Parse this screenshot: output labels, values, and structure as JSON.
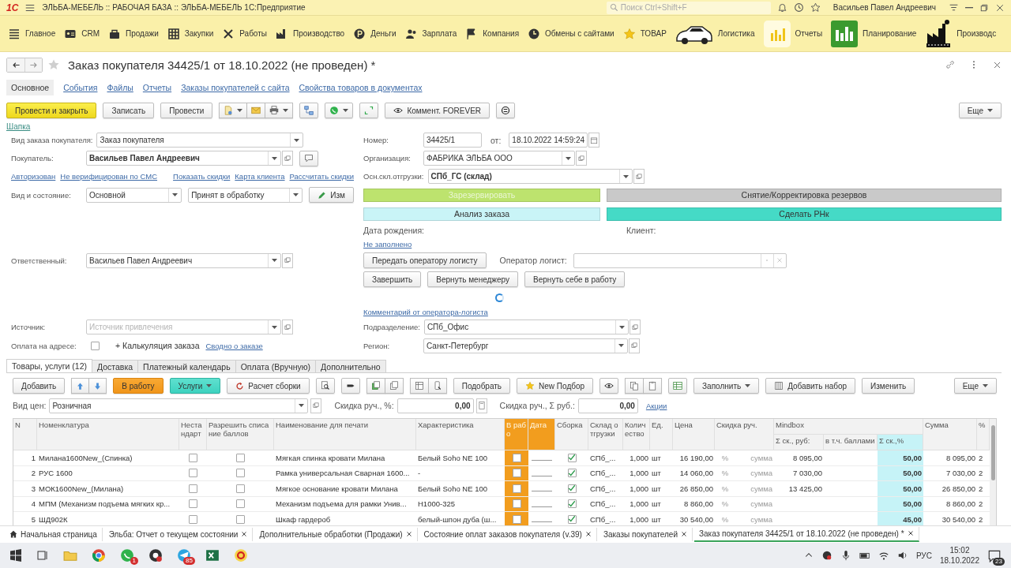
{
  "app_bar": {
    "logo": "1С",
    "title": "ЭЛЬБА-МЕБЕЛЬ :: РАБОЧАЯ БАЗА :: ЭЛЬБА-МЕБЕЛЬ 1С:Предприятие",
    "search": {
      "placeholder": "Поиск Ctrl+Shift+F"
    },
    "user": "Васильев Павел Андреевич"
  },
  "sections": [
    {
      "label": "Главное"
    },
    {
      "label": "CRM"
    },
    {
      "label": "Продажи"
    },
    {
      "label": "Закупки"
    },
    {
      "label": "Работы"
    },
    {
      "label": "Производство"
    },
    {
      "label": "Деньги"
    },
    {
      "label": "Зарплата"
    },
    {
      "label": "Компания"
    },
    {
      "label": "Обмены с сайтами"
    },
    {
      "label": "ТОВАР"
    },
    {
      "label": "Логистика"
    },
    {
      "label": "Отчеты"
    },
    {
      "label": "Планирование"
    },
    {
      "label": "Производс"
    }
  ],
  "form": {
    "title": "Заказ покупателя 34425/1 от 18.10.2022 (не проведен) *",
    "nav": [
      {
        "label": "Основное",
        "selected": true
      },
      {
        "label": "События",
        "selected": false
      },
      {
        "label": "Файлы",
        "selected": false
      },
      {
        "label": "Отчеты",
        "selected": false
      },
      {
        "label": "Заказы покупателей с сайта",
        "selected": false
      },
      {
        "label": "Свойства товаров в документах",
        "selected": false
      }
    ],
    "toolbar": {
      "post_close": "Провести и закрыть",
      "save": "Записать",
      "post": "Провести",
      "comment": "Коммент. FOREVER",
      "more": "Еще"
    },
    "group_link": "Шапка",
    "order_kind": {
      "label": "Вид заказа покупателя:",
      "value": "Заказ покупателя"
    },
    "customer": {
      "label": "Покупатель:",
      "value": "Васильев Павел Андреевич"
    },
    "customer_links": [
      "Авторизован",
      "Не верифицирован по СМС",
      "Показать скидки",
      "Карта клиента",
      "Рассчитать скидки"
    ],
    "type_state": {
      "label": "Вид и состояние:",
      "type": "Основной",
      "state": "Принят в обработку",
      "button": "Изм"
    },
    "responsible": {
      "label": "Ответственный:",
      "value": "Васильев Павел Андреевич"
    },
    "source": {
      "label": "Источник:",
      "placeholder": "Источник привлечения"
    },
    "pay_on_address": {
      "label": "Оплата на адресе:",
      "checked": false
    },
    "calc_button": "+ Калькуляция заказа",
    "summary_link": "Сводно о заказе",
    "number": {
      "label": "Номер:",
      "value": "34425/1",
      "date_label": "от:",
      "date": "18.10.2022 14:59:24"
    },
    "organization": {
      "label": "Организация:",
      "value": "ФАБРИКА ЭЛЬБА ООО"
    },
    "warehouse": {
      "label": "Осн.скл.отгрузки:",
      "value": "СПб_ГС (склад)"
    },
    "action_buttons": [
      {
        "label": "Зарезервировать",
        "color": "#bde36e",
        "disabled": true
      },
      {
        "label": "Снятие/Корректировка резервов",
        "color": "#c9c9c9",
        "disabled": false
      },
      {
        "label": "Анализ заказа",
        "color": "#c9f4f7",
        "disabled": false
      },
      {
        "label": "Сделать РНк",
        "color": "#45dac6",
        "disabled": false
      }
    ],
    "birth_label": "Дата рождения:",
    "client_label": "Клиент:",
    "not_filled_link": "Не заполнено",
    "pass_button": "Передать оператору логисту",
    "operator": {
      "label": "Оператор логист:"
    },
    "flow_buttons": [
      "Завершить",
      "Вернуть менеджеру",
      "Вернуть себе в работу"
    ],
    "comment_link": "Комментарий от оператора-логиста",
    "department": {
      "label": "Подразделение:",
      "value": "СПб_Офис"
    },
    "region": {
      "label": "Регион:",
      "value": "Санкт-Петербург"
    }
  },
  "tabs": [
    {
      "label": "Товары, услуги (12)",
      "selected": true
    },
    {
      "label": "Доставка",
      "selected": false
    },
    {
      "label": "Платежный календарь",
      "selected": false
    },
    {
      "label": "Оплата (Вручную)",
      "selected": false
    },
    {
      "label": "Дополнительно",
      "selected": false
    }
  ],
  "table_toolbar": {
    "add": "Добавить",
    "to_work": "В работу",
    "services": "Услуги",
    "assembly_calc": "Расчет сборки",
    "pick": "Подобрать",
    "new_pick": "New Подбор",
    "fill": "Заполнить",
    "add_set": "Добавить набор",
    "change": "Изменить",
    "more": "Еще"
  },
  "price_row": {
    "price_kind": {
      "label": "Вид цен:",
      "value": "Розничная"
    },
    "disc_pct": {
      "label": "Скидка руч., %:",
      "value": "0,00"
    },
    "disc_sum": {
      "label": "Скидка руч., Σ руб.:",
      "value": "0,00"
    },
    "promo_link": "Акции"
  },
  "table": {
    "columns": [
      {
        "label": "N"
      },
      {
        "label": "Номенклатура"
      },
      {
        "label": "Нестандарт"
      },
      {
        "label": "Разрешить списание баллов"
      },
      {
        "label": "Наименование для печати"
      },
      {
        "label": "Характеристика"
      },
      {
        "label": "В рабо"
      },
      {
        "label": "Дата"
      },
      {
        "label": "Сборка"
      },
      {
        "label": "Склад отгрузки"
      },
      {
        "label": "Количество"
      },
      {
        "label": "Ед."
      },
      {
        "label": "Цена"
      },
      {
        "label": "Скидка руч."
      },
      {
        "label": "Mindbox",
        "sub": [
          "Σ ск., руб:",
          "в т.ч. баллами",
          "Σ ск.,%"
        ]
      },
      {
        "label": "Сумма"
      },
      {
        "label": "%"
      }
    ],
    "rows": [
      {
        "n": "1",
        "item": "Милана1600New_(Спинка)",
        "nonstandard": false,
        "allow_points": false,
        "print_name": "Мягкая спинка кровати  Милана",
        "feature": "Белый Soho NE 100",
        "in_work": false,
        "assembly": true,
        "warehouse": "СПб_...",
        "qty": "1,000",
        "unit": "шт",
        "price": "16 190,00",
        "disc_pct": "%",
        "disc_sum": "сумма",
        "mb_rub": "8 095,00",
        "mb_pct": "50,00",
        "sum": "8 095,00",
        "pct": "2"
      },
      {
        "n": "2",
        "item": "РУС 1600",
        "nonstandard": false,
        "allow_points": false,
        "print_name": "Рамка универсальная Сварная 1600...",
        "feature": "-",
        "in_work": false,
        "assembly": true,
        "warehouse": "СПб_...",
        "qty": "1,000",
        "unit": "шт",
        "price": "14 060,00",
        "disc_pct": "%",
        "disc_sum": "сумма",
        "mb_rub": "7 030,00",
        "mb_pct": "50,00",
        "sum": "7 030,00",
        "pct": "2"
      },
      {
        "n": "3",
        "item": "МОК1600New_(Милана)",
        "nonstandard": false,
        "allow_points": false,
        "print_name": "Мягкое основание кровати  Милана",
        "feature": "Белый Soho NE 100",
        "in_work": false,
        "assembly": true,
        "warehouse": "СПб_...",
        "qty": "1,000",
        "unit": "шт",
        "price": "26 850,00",
        "disc_pct": "%",
        "disc_sum": "сумма",
        "mb_rub": "13 425,00",
        "mb_pct": "50,00",
        "sum": "26 850,00",
        "pct": "2"
      },
      {
        "n": "4",
        "item": "МПМ (Механизм подъема мягких кр...",
        "nonstandard": false,
        "allow_points": false,
        "print_name": "Механизм подъема для  рамки Унив...",
        "feature": "Н1000-325",
        "in_work": false,
        "assembly": true,
        "warehouse": "СПб_...",
        "qty": "1,000",
        "unit": "шт",
        "price": "8 860,00",
        "disc_pct": "%",
        "disc_sum": "сумма",
        "mb_pct": "50,00",
        "sum": "8 860,00",
        "pct": "2"
      },
      {
        "n": "5",
        "item": "ШД902К",
        "nonstandard": false,
        "allow_points": false,
        "print_name": "Шкаф гардероб",
        "feature": "белый-шпон дуба (ш...",
        "in_work": false,
        "assembly": true,
        "warehouse": "СПб_...",
        "qty": "1,000",
        "unit": "шт",
        "price": "30 540,00",
        "disc_pct": "%",
        "disc_sum": "сумма",
        "mb_pct": "45,00",
        "sum": "30 540,00",
        "pct": "2"
      }
    ]
  },
  "open_windows": [
    {
      "label": "Начальная страница",
      "selected": false
    },
    {
      "label": "Эльба: Отчет о текущем состоянии",
      "selected": false
    },
    {
      "label": "Дополнительные обработки (Продажи)",
      "selected": false
    },
    {
      "label": "Состояние оплат заказов покупателя (v.39)",
      "selected": false
    },
    {
      "label": "Заказы покупателей",
      "selected": false
    },
    {
      "label": "Заказ покупателя 34425/1 от 18.10.2022 (не проведен) *",
      "selected": true
    }
  ],
  "taskbar": {
    "app_badges": [
      "1",
      "85"
    ],
    "lang": "РУС",
    "time": "15:02",
    "date": "18.10.2022",
    "notifications": "23"
  }
}
